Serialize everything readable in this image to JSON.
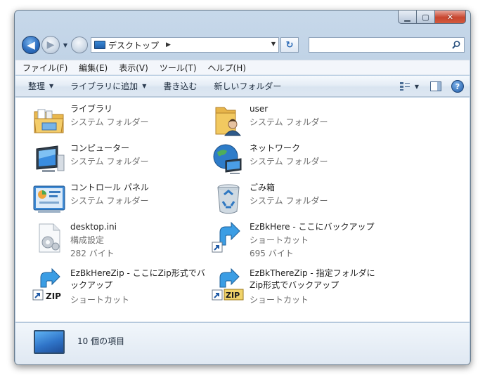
{
  "address": {
    "location": "デスクトップ"
  },
  "search": {
    "placeholder": ""
  },
  "menu": [
    "ファイル(F)",
    "編集(E)",
    "表示(V)",
    "ツール(T)",
    "ヘルプ(H)"
  ],
  "toolbar": {
    "organize": "整理",
    "library": "ライブラリに追加",
    "burn": "書き込む",
    "new_folder": "新しいフォルダー"
  },
  "items": [
    {
      "name": "ライブラリ",
      "sub1": "システム フォルダー",
      "sub2": "",
      "icon": "library-icon"
    },
    {
      "name": "user",
      "sub1": "システム フォルダー",
      "sub2": "",
      "icon": "user-folder-icon"
    },
    {
      "name": "コンピューター",
      "sub1": "システム フォルダー",
      "sub2": "",
      "icon": "computer-icon"
    },
    {
      "name": "ネットワーク",
      "sub1": "システム フォルダー",
      "sub2": "",
      "icon": "network-icon"
    },
    {
      "name": "コントロール パネル",
      "sub1": "システム フォルダー",
      "sub2": "",
      "icon": "control-panel-icon"
    },
    {
      "name": "ごみ箱",
      "sub1": "システム フォルダー",
      "sub2": "",
      "icon": "recycle-bin-icon"
    },
    {
      "name": "desktop.ini",
      "sub1": "構成設定",
      "sub2": "282 バイト",
      "icon": "ini-file-icon"
    },
    {
      "name": "EzBkHere - ここにバックアップ",
      "sub1": "ショートカット",
      "sub2": "695 バイト",
      "icon": "shortcut-arrow-icon"
    },
    {
      "name": "EzBkHereZip - ここにZip形式でバックアップ",
      "sub1": "",
      "sub2": "ショートカット",
      "icon": "zip-shortcut-icon",
      "zip_label": "ZIP"
    },
    {
      "name": "EzBkThereZip - 指定フォルダにZip形式でバックアップ",
      "sub1": "",
      "sub2": "ショートカット",
      "icon": "zip-shortcut-icon",
      "zip_label": "ZIP"
    }
  ],
  "details": {
    "count_text": "10 個の項目"
  },
  "colors": {
    "accent": "#2f74c8",
    "window_frame": "#b9cde2",
    "muted_text": "#6d6d6d"
  }
}
